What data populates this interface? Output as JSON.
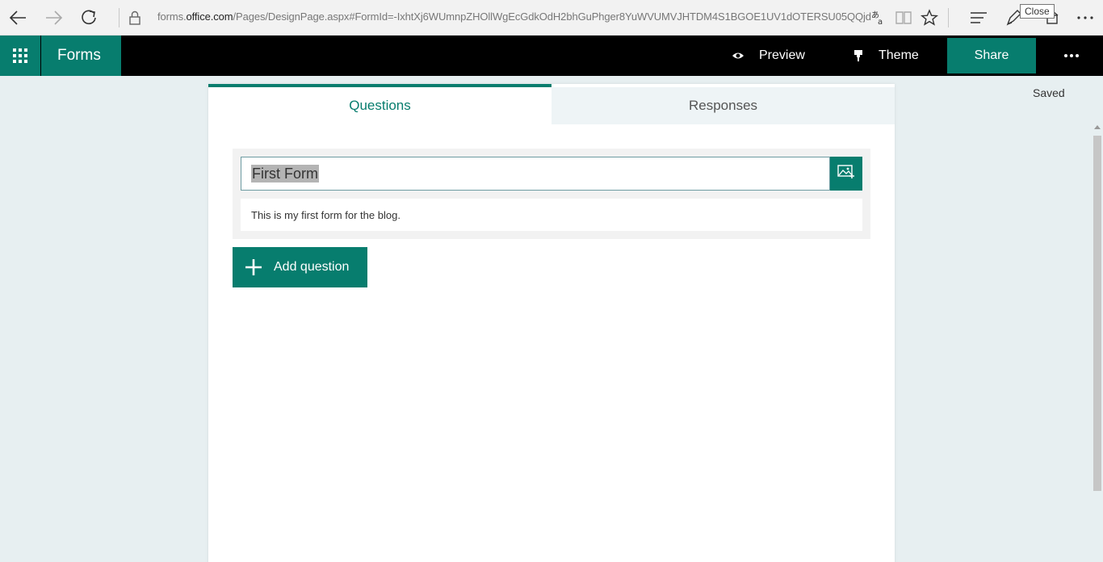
{
  "browser": {
    "url_prefix": "forms.",
    "url_host": "office.com",
    "url_path": "/Pages/DesignPage.aspx#FormId=-IxhtXj6WUmnpZHOllWgEcGdkOdH2bhGuPhger8YuWVUMVJHTDM4S1BGOE1UV1dOTERSU05QQjd",
    "tooltip": "Close"
  },
  "header": {
    "app_name": "Forms",
    "preview_label": "Preview",
    "theme_label": "Theme",
    "share_label": "Share"
  },
  "status": {
    "saved": "Saved"
  },
  "tabs": [
    {
      "label": "Questions",
      "active": true
    },
    {
      "label": "Responses",
      "active": false
    }
  ],
  "form": {
    "title": "First Form",
    "description": "This is my first form for the blog."
  },
  "actions": {
    "add_question": "Add question"
  },
  "colors": {
    "accent": "#077d6e",
    "header_bg": "#000000",
    "page_bg": "#e7eff1"
  },
  "icons": {
    "back": "back-arrow-icon",
    "forward": "forward-arrow-icon",
    "refresh": "refresh-icon",
    "lock": "lock-icon",
    "waffle": "app-launcher-icon",
    "preview": "eye-icon",
    "theme": "paint-brush-icon",
    "insert_image": "insert-image-icon",
    "add": "plus-icon"
  }
}
